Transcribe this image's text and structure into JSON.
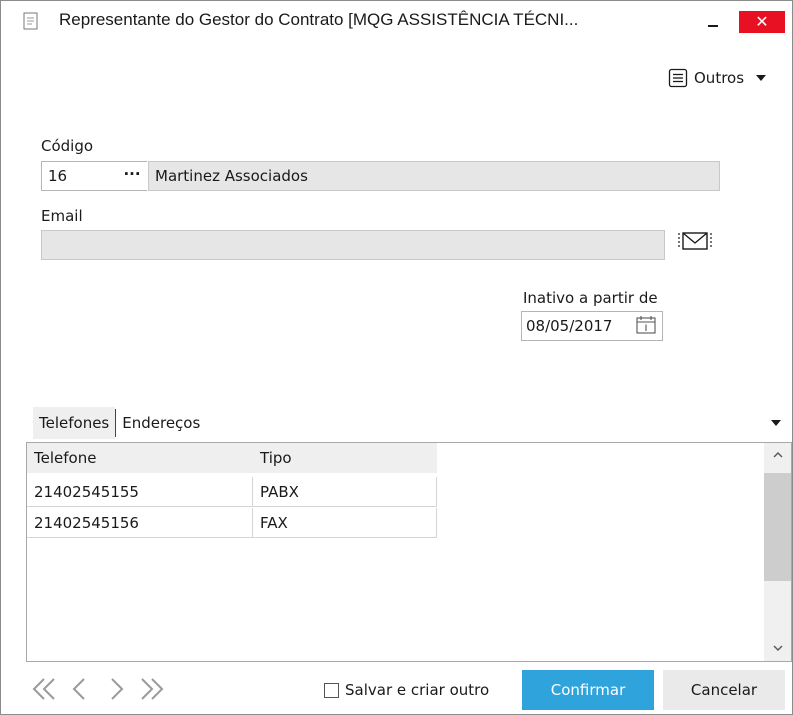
{
  "window": {
    "title": "Representante do Gestor do Contrato [MQG ASSISTÊNCIA TÉCNI...",
    "minimize_icon": "minimize-icon",
    "close_label": "✕"
  },
  "toolbar": {
    "outros_label": "Outros",
    "outros_icon": "list-icon"
  },
  "form": {
    "codigo_label": "Código",
    "codigo_value": "16",
    "lookup_button_label": "···",
    "codigo_name": "Martinez Associados",
    "email_label": "Email",
    "email_value": "",
    "email_icon": "envelope-icon",
    "inativo_label": "Inativo a partir de",
    "inativo_value": "08/05/2017",
    "calendar_icon": "calendar-icon"
  },
  "tabs": [
    {
      "label": "Telefones",
      "active": true
    },
    {
      "label": "Endereços",
      "active": false
    }
  ],
  "grid": {
    "columns": [
      "Telefone",
      "Tipo"
    ],
    "rows": [
      [
        "21402545155",
        "PABX"
      ],
      [
        "21402545156",
        "FAX"
      ]
    ]
  },
  "footer": {
    "nav_icons": [
      "first-icon",
      "previous-icon",
      "next-icon",
      "last-icon"
    ],
    "checkbox_label": "Salvar e criar outro",
    "checkbox_checked": false,
    "confirm_label": "Confirmar",
    "cancel_label": "Cancelar"
  },
  "colors": {
    "close": "#e81123",
    "confirm": "#2ea3dc",
    "readonly_field": "#e6e6e6"
  }
}
